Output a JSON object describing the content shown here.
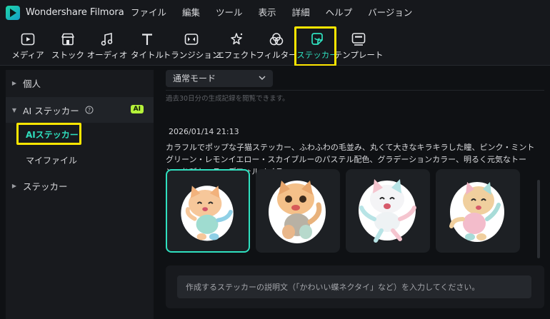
{
  "app": {
    "title": "Wondershare Filmora"
  },
  "menu": [
    "ファイル",
    "編集",
    "ツール",
    "表示",
    "詳細",
    "ヘルプ",
    "バージョン"
  ],
  "toolbar": {
    "items": [
      {
        "label": "メディア",
        "icon": "media-icon"
      },
      {
        "label": "ストック",
        "icon": "stock-icon"
      },
      {
        "label": "オーディオ",
        "icon": "audio-icon"
      },
      {
        "label": "タイトル",
        "icon": "title-icon"
      },
      {
        "label": "トランジション",
        "icon": "transition-icon"
      },
      {
        "label": "エフェクト",
        "icon": "effect-icon"
      },
      {
        "label": "フィルター",
        "icon": "filter-icon"
      },
      {
        "label": "ステッカー",
        "icon": "sticker-icon",
        "active": true
      },
      {
        "label": "テンプレート",
        "icon": "template-icon"
      }
    ],
    "accent": "#2fe0bf"
  },
  "sidebar": {
    "personal": "個人",
    "ai_sticker": "AI ステッカー",
    "ai_badge": "AI",
    "ai_sticker_sub": "AIステッカー",
    "my_files": "マイファイル",
    "sticker": "ステッカー"
  },
  "main": {
    "mode": "通常モード",
    "notice": "過去30日分の生成記録を閲覧できます。",
    "timestamp": "2026/01/14 21:13",
    "prompt": "カラフルでポップな子猫ステッカー、ふわふわの毛並み、丸くて大きなキラキラした瞳、ピンク・ミントグリーン・レモンイエロー・スカイブルーのパステル配色、グラデーションカラー、明るく元気なトーン、ちびキャラ・デフォルメイラ…",
    "input_placeholder": "作成するステッカーの説明文（「かわいい蝶ネクタイ」など）を入力してください。"
  },
  "highlight_color": "#ffe600"
}
